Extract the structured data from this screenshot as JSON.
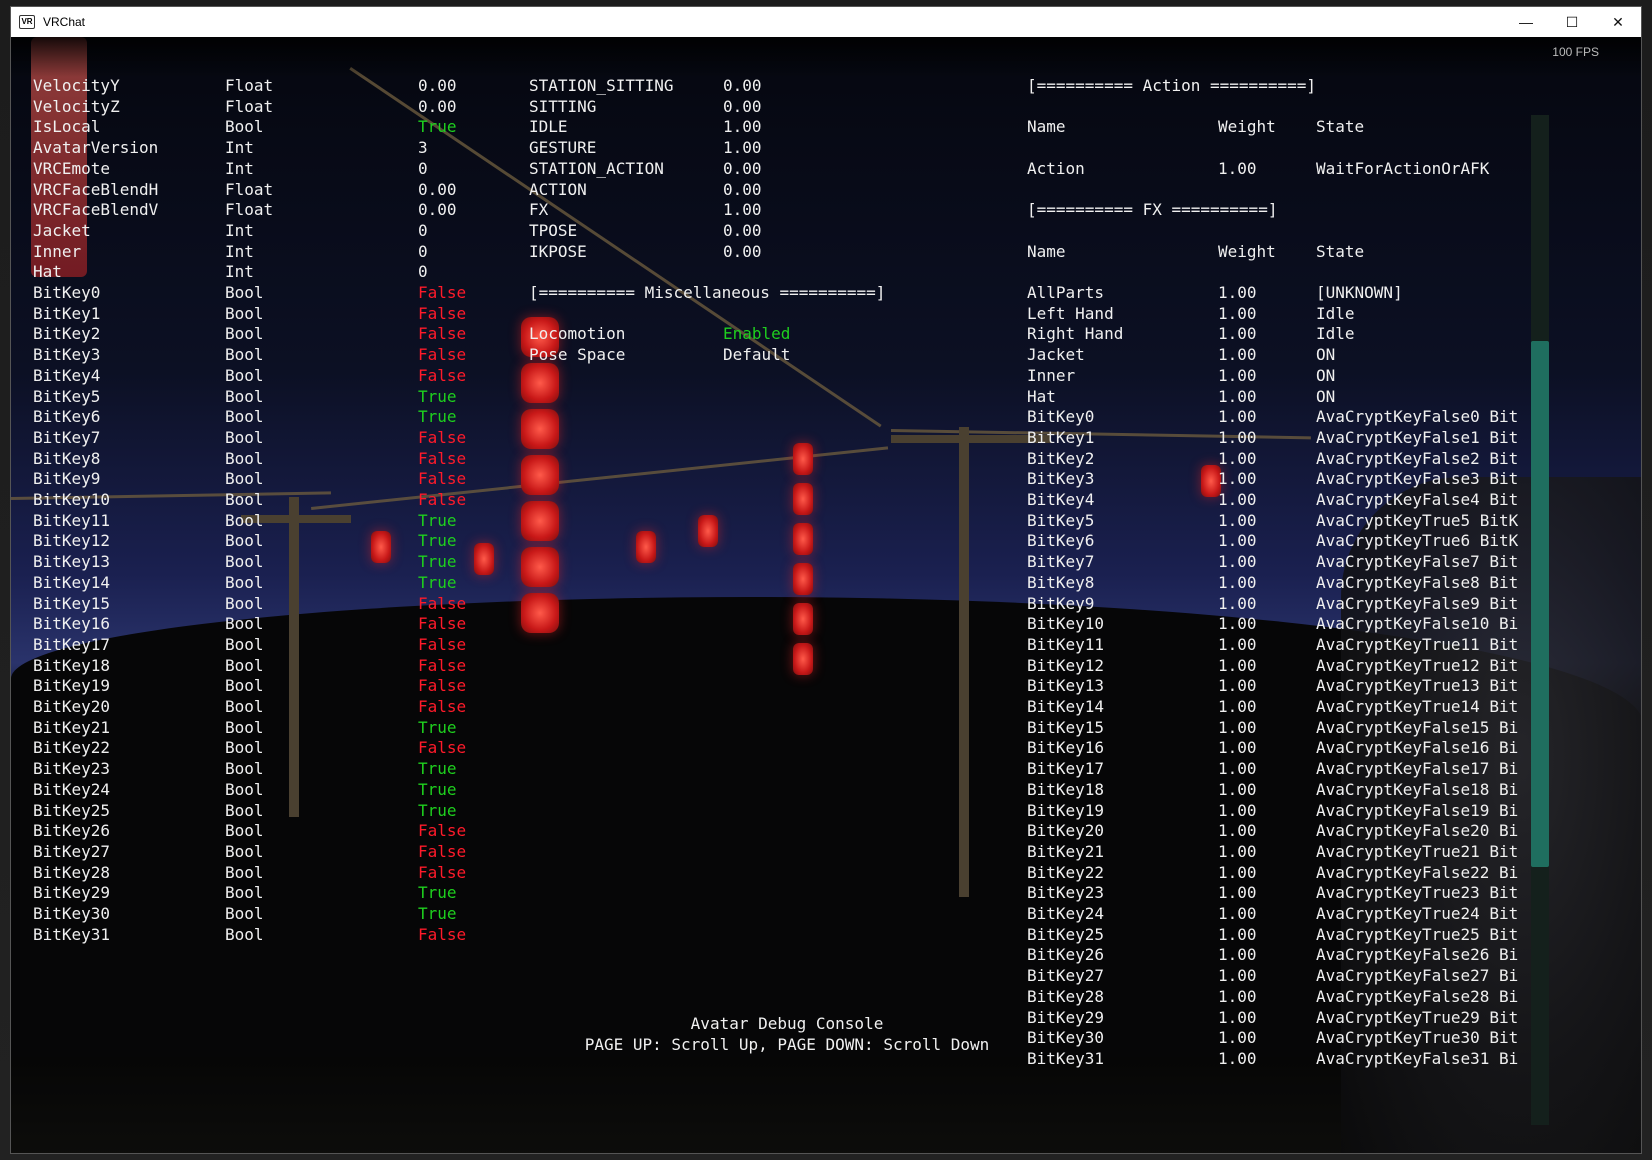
{
  "window": {
    "title": "VRChat",
    "icon_text": "VR",
    "minimize": "—",
    "maximize": "☐",
    "close": "✕"
  },
  "fps": "100 FPS",
  "parameters": {
    "rows": [
      [
        "VelocityY",
        "Float",
        "0.00",
        ""
      ],
      [
        "VelocityZ",
        "Float",
        "0.00",
        ""
      ],
      [
        "IsLocal",
        "Bool",
        "True",
        "true"
      ],
      [
        "AvatarVersion",
        "Int",
        "3",
        ""
      ],
      [
        "VRCEmote",
        "Int",
        "0",
        ""
      ],
      [
        "VRCFaceBlendH",
        "Float",
        "0.00",
        ""
      ],
      [
        "VRCFaceBlendV",
        "Float",
        "0.00",
        ""
      ],
      [
        "Jacket",
        "Int",
        "0",
        ""
      ],
      [
        "Inner",
        "Int",
        "0",
        ""
      ],
      [
        "Hat",
        "Int",
        "0",
        ""
      ],
      [
        "BitKey0",
        "Bool",
        "False",
        "false"
      ],
      [
        "BitKey1",
        "Bool",
        "False",
        "false"
      ],
      [
        "BitKey2",
        "Bool",
        "False",
        "false"
      ],
      [
        "BitKey3",
        "Bool",
        "False",
        "false"
      ],
      [
        "BitKey4",
        "Bool",
        "False",
        "false"
      ],
      [
        "BitKey5",
        "Bool",
        "True",
        "true"
      ],
      [
        "BitKey6",
        "Bool",
        "True",
        "true"
      ],
      [
        "BitKey7",
        "Bool",
        "False",
        "false"
      ],
      [
        "BitKey8",
        "Bool",
        "False",
        "false"
      ],
      [
        "BitKey9",
        "Bool",
        "False",
        "false"
      ],
      [
        "BitKey10",
        "Bool",
        "False",
        "false"
      ],
      [
        "BitKey11",
        "Bool",
        "True",
        "true"
      ],
      [
        "BitKey12",
        "Bool",
        "True",
        "true"
      ],
      [
        "BitKey13",
        "Bool",
        "True",
        "true"
      ],
      [
        "BitKey14",
        "Bool",
        "True",
        "true"
      ],
      [
        "BitKey15",
        "Bool",
        "False",
        "false"
      ],
      [
        "BitKey16",
        "Bool",
        "False",
        "false"
      ],
      [
        "BitKey17",
        "Bool",
        "False",
        "false"
      ],
      [
        "BitKey18",
        "Bool",
        "False",
        "false"
      ],
      [
        "BitKey19",
        "Bool",
        "False",
        "false"
      ],
      [
        "BitKey20",
        "Bool",
        "False",
        "false"
      ],
      [
        "BitKey21",
        "Bool",
        "True",
        "true"
      ],
      [
        "BitKey22",
        "Bool",
        "False",
        "false"
      ],
      [
        "BitKey23",
        "Bool",
        "True",
        "true"
      ],
      [
        "BitKey24",
        "Bool",
        "True",
        "true"
      ],
      [
        "BitKey25",
        "Bool",
        "True",
        "true"
      ],
      [
        "BitKey26",
        "Bool",
        "False",
        "false"
      ],
      [
        "BitKey27",
        "Bool",
        "False",
        "false"
      ],
      [
        "BitKey28",
        "Bool",
        "False",
        "false"
      ],
      [
        "BitKey29",
        "Bool",
        "True",
        "true"
      ],
      [
        "BitKey30",
        "Bool",
        "True",
        "true"
      ],
      [
        "BitKey31",
        "Bool",
        "False",
        "false"
      ]
    ]
  },
  "layers": {
    "rows": [
      [
        "STATION_SITTING",
        "0.00"
      ],
      [
        "SITTING",
        "0.00"
      ],
      [
        "IDLE",
        "1.00"
      ],
      [
        "GESTURE",
        "1.00"
      ],
      [
        "STATION_ACTION",
        "0.00"
      ],
      [
        "ACTION",
        "0.00"
      ],
      [
        "FX",
        "1.00"
      ],
      [
        "TPOSE",
        "0.00"
      ],
      [
        "IKPOSE",
        "0.00"
      ]
    ]
  },
  "misc": {
    "header": "[========== Miscellaneous ==========]",
    "rows": [
      [
        "Locomotion",
        "Enabled",
        "enabled"
      ],
      [
        "Pose Space",
        "Default",
        ""
      ]
    ]
  },
  "action": {
    "header": "[========== Action ==========]",
    "col_name": "Name",
    "col_weight": "Weight",
    "col_state": "State",
    "rows": [
      [
        "Action",
        "1.00",
        "WaitForActionOrAFK"
      ]
    ]
  },
  "fx": {
    "header": "[========== FX ==========]",
    "col_name": "Name",
    "col_weight": "Weight",
    "col_state": "State",
    "rows": [
      [
        "AllParts",
        "1.00",
        "[UNKNOWN]"
      ],
      [
        "Left Hand",
        "1.00",
        "Idle"
      ],
      [
        "Right Hand",
        "1.00",
        "Idle"
      ],
      [
        "Jacket",
        "1.00",
        "ON"
      ],
      [
        "Inner",
        "1.00",
        "ON"
      ],
      [
        "Hat",
        "1.00",
        "ON"
      ],
      [
        "BitKey0",
        "1.00",
        "AvaCryptKeyFalse0 Bit"
      ],
      [
        "BitKey1",
        "1.00",
        "AvaCryptKeyFalse1 Bit"
      ],
      [
        "BitKey2",
        "1.00",
        "AvaCryptKeyFalse2 Bit"
      ],
      [
        "BitKey3",
        "1.00",
        "AvaCryptKeyFalse3 Bit"
      ],
      [
        "BitKey4",
        "1.00",
        "AvaCryptKeyFalse4 Bit"
      ],
      [
        "BitKey5",
        "1.00",
        "AvaCryptKeyTrue5 BitK"
      ],
      [
        "BitKey6",
        "1.00",
        "AvaCryptKeyTrue6 BitK"
      ],
      [
        "BitKey7",
        "1.00",
        "AvaCryptKeyFalse7 Bit"
      ],
      [
        "BitKey8",
        "1.00",
        "AvaCryptKeyFalse8 Bit"
      ],
      [
        "BitKey9",
        "1.00",
        "AvaCryptKeyFalse9 Bit"
      ],
      [
        "BitKey10",
        "1.00",
        "AvaCryptKeyFalse10 Bi"
      ],
      [
        "BitKey11",
        "1.00",
        "AvaCryptKeyTrue11 Bit"
      ],
      [
        "BitKey12",
        "1.00",
        "AvaCryptKeyTrue12 Bit"
      ],
      [
        "BitKey13",
        "1.00",
        "AvaCryptKeyTrue13 Bit"
      ],
      [
        "BitKey14",
        "1.00",
        "AvaCryptKeyTrue14 Bit"
      ],
      [
        "BitKey15",
        "1.00",
        "AvaCryptKeyFalse15 Bi"
      ],
      [
        "BitKey16",
        "1.00",
        "AvaCryptKeyFalse16 Bi"
      ],
      [
        "BitKey17",
        "1.00",
        "AvaCryptKeyFalse17 Bi"
      ],
      [
        "BitKey18",
        "1.00",
        "AvaCryptKeyFalse18 Bi"
      ],
      [
        "BitKey19",
        "1.00",
        "AvaCryptKeyFalse19 Bi"
      ],
      [
        "BitKey20",
        "1.00",
        "AvaCryptKeyFalse20 Bi"
      ],
      [
        "BitKey21",
        "1.00",
        "AvaCryptKeyTrue21 Bit"
      ],
      [
        "BitKey22",
        "1.00",
        "AvaCryptKeyFalse22 Bi"
      ],
      [
        "BitKey23",
        "1.00",
        "AvaCryptKeyTrue23 Bit"
      ],
      [
        "BitKey24",
        "1.00",
        "AvaCryptKeyTrue24 Bit"
      ],
      [
        "BitKey25",
        "1.00",
        "AvaCryptKeyTrue25 Bit"
      ],
      [
        "BitKey26",
        "1.00",
        "AvaCryptKeyFalse26 Bi"
      ],
      [
        "BitKey27",
        "1.00",
        "AvaCryptKeyFalse27 Bi"
      ],
      [
        "BitKey28",
        "1.00",
        "AvaCryptKeyFalse28 Bi"
      ],
      [
        "BitKey29",
        "1.00",
        "AvaCryptKeyTrue29 Bit"
      ],
      [
        "BitKey30",
        "1.00",
        "AvaCryptKeyTrue30 Bit"
      ],
      [
        "BitKey31",
        "1.00",
        "AvaCryptKeyFalse31 Bi"
      ]
    ]
  },
  "footer": {
    "title": "Avatar Debug Console",
    "hint": "PAGE UP: Scroll Up, PAGE DOWN: Scroll Down"
  },
  "colors": {
    "true": "#1ecf1e",
    "false": "#ff1a2a",
    "scroll_thumb": "#1f6e5f"
  }
}
